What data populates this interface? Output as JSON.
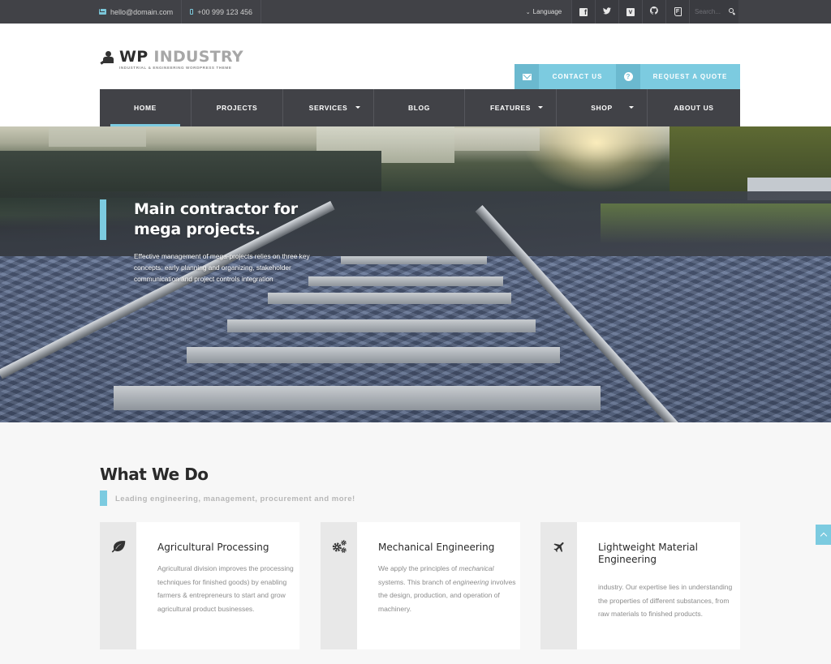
{
  "topbar": {
    "email": "hello@domain.com",
    "phone": "+00 999 123 456",
    "language_label": "Language",
    "social": [
      {
        "name": "facebook-icon",
        "glyph": "f"
      },
      {
        "name": "twitter-icon",
        "glyph": "t"
      },
      {
        "name": "vimeo-icon",
        "glyph": "v"
      },
      {
        "name": "github-icon",
        "glyph": "◕"
      },
      {
        "name": "foursquare-icon",
        "glyph": "F"
      }
    ],
    "search_placeholder": "Search..."
  },
  "header": {
    "logo_wp": "WP",
    "logo_industry": "INDUSTRY",
    "logo_tagline": "INDUSTRIAL & ENGINEERING WORDPRESS THEME",
    "contact_button": "CONTACT US",
    "quote_button": "REQUEST A QUOTE",
    "quote_icon_glyph": "?"
  },
  "nav": {
    "items": [
      {
        "label": "HOME",
        "active": true,
        "dropdown": false
      },
      {
        "label": "PROJECTS",
        "active": false,
        "dropdown": false
      },
      {
        "label": "SERVICES",
        "active": false,
        "dropdown": true
      },
      {
        "label": "BLOG",
        "active": false,
        "dropdown": false
      },
      {
        "label": "FEATURES",
        "active": false,
        "dropdown": true
      },
      {
        "label": "SHOP",
        "active": false,
        "dropdown": true
      },
      {
        "label": "ABOUT US",
        "active": false,
        "dropdown": false
      }
    ]
  },
  "hero": {
    "title": "Main contractor for mega projects.",
    "description": "Effective management of mega-projects relies on three key concepts: early planning and organizing, stakeholder communication and project controls integration"
  },
  "what_we_do": {
    "title": "What We Do",
    "subtitle": "Leading engineering, management, procurement and more!",
    "cards": [
      {
        "icon": "leaf-icon",
        "title": "Agricultural Processing",
        "description": "Agricultural division improves the processing techniques for finished goods) by enabling farmers & entrepreneurs to start and grow agricultural product businesses."
      },
      {
        "icon": "gears-icon",
        "title": "Mechanical Engineering",
        "description_parts": [
          "We apply the principles of ",
          "mechanical",
          " systems. This branch of ",
          "engineering",
          " involves the design, production, and operation of machinery."
        ]
      },
      {
        "icon": "plane-icon",
        "title": "Lightweight Material Engineering",
        "description": "industry. Our expertise lies in understanding the properties of different substances, from raw materials to finished products."
      }
    ]
  },
  "colors": {
    "accent": "#7ccbe0",
    "dark": "#414247"
  }
}
